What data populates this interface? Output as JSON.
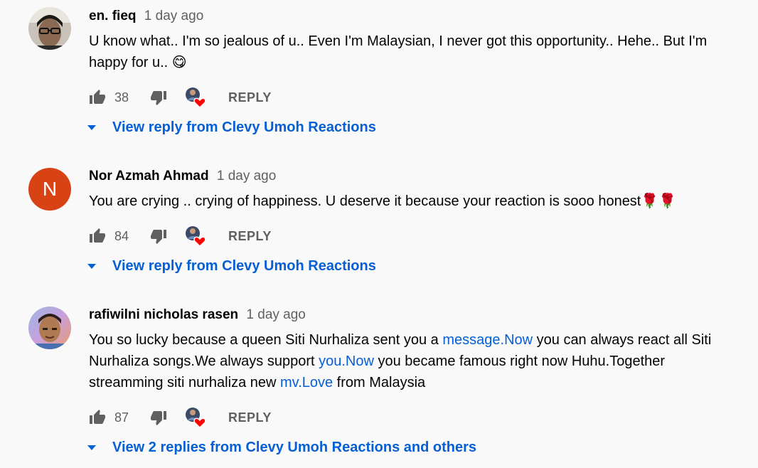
{
  "comments": [
    {
      "author": "en. fieq",
      "time": "1 day ago",
      "text_parts": [
        {
          "text": "U know what.. I'm so jealous of u.. Even I'm Malaysian, I never got this opportunity.. Hehe.. But I'm happy for u.. ",
          "link": false
        },
        {
          "text": "😋",
          "link": false
        }
      ],
      "likes": "38",
      "reply_label": "REPLY",
      "view_replies": "View reply from Clevy Umoh Reactions",
      "avatar": {
        "type": "photo",
        "name": "user-photo"
      }
    },
    {
      "author": "Nor Azmah Ahmad",
      "time": "1 day ago",
      "text_parts": [
        {
          "text": "You are crying .. crying of happiness. U deserve it because your reaction is sooo honest",
          "link": false
        },
        {
          "text": "🌹🌹",
          "link": false
        }
      ],
      "likes": "84",
      "reply_label": "REPLY",
      "view_replies": "View reply from Clevy Umoh Reactions",
      "avatar": {
        "type": "letter",
        "letter": "N",
        "color": "#d84315"
      }
    },
    {
      "author": "rafiwilni nicholas rasen",
      "time": "1 day ago",
      "text_parts": [
        {
          "text": "You so lucky because a queen Siti Nurhaliza sent you a ",
          "link": false
        },
        {
          "text": "message.Now",
          "link": true
        },
        {
          "text": " you can always react all Siti Nurhaliza  songs.We always support ",
          "link": false
        },
        {
          "text": "you.Now",
          "link": true
        },
        {
          "text": " you became famous right now Huhu.Together streamming siti nurhaliza new ",
          "link": false
        },
        {
          "text": "mv.Love",
          "link": true
        },
        {
          "text": " from Malaysia",
          "link": false
        }
      ],
      "likes": "87",
      "reply_label": "REPLY",
      "view_replies": "View 2 replies from Clevy Umoh Reactions and others",
      "avatar": {
        "type": "photo",
        "name": "user-photo"
      }
    }
  ],
  "colors": {
    "link": "#065fd4",
    "secondary_text": "#606060",
    "heart": "#ff0000",
    "background": "#f9f9f9"
  },
  "icons": {
    "like": "thumbs-up-icon",
    "dislike": "thumbs-down-icon",
    "creator_heart": "creator-heart-icon",
    "expand": "caret-down-icon"
  }
}
